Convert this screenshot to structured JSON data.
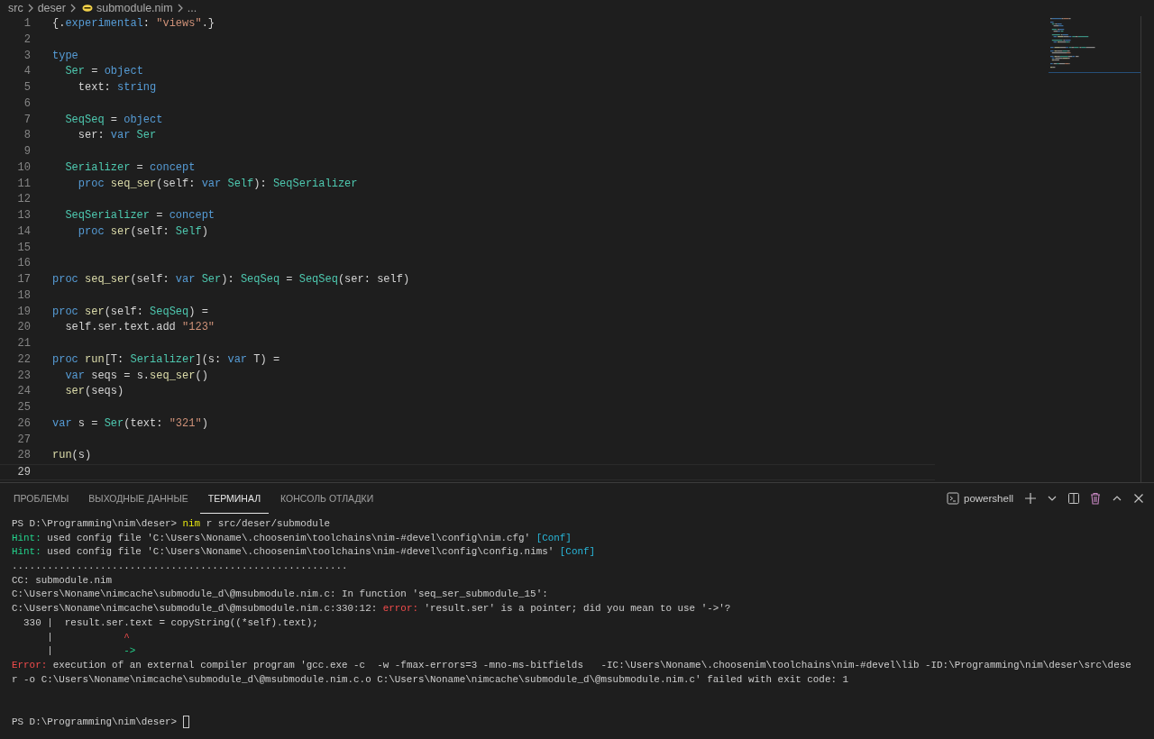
{
  "breadcrumb": [
    {
      "label": "src",
      "kind": "folder"
    },
    {
      "label": "deser",
      "kind": "folder"
    },
    {
      "label": "submodule.nim",
      "kind": "file"
    },
    {
      "label": "...",
      "kind": "more"
    }
  ],
  "editor": {
    "lines": [
      {
        "number": "1",
        "current": false,
        "segments": [
          {
            "kind": "plain",
            "text": "{."
          },
          {
            "kind": "keyword",
            "text": "experimental"
          },
          {
            "kind": "plain",
            "text": ": "
          },
          {
            "kind": "string",
            "text": "\"views\""
          },
          {
            "kind": "plain",
            "text": ".}"
          }
        ]
      },
      {
        "number": "2",
        "current": false
      },
      {
        "number": "3",
        "current": false,
        "segments": [
          {
            "kind": "keyword",
            "text": "type"
          }
        ]
      },
      {
        "number": "4",
        "current": false,
        "segments": [
          {
            "kind": "type",
            "text": "  Ser"
          },
          {
            "kind": "plain",
            "text": " = "
          },
          {
            "kind": "keyword",
            "text": "object"
          }
        ]
      },
      {
        "number": "5",
        "current": false,
        "segments": [
          {
            "kind": "plain",
            "text": "    text: "
          },
          {
            "kind": "keyword",
            "text": "string"
          }
        ]
      },
      {
        "number": "6",
        "current": false
      },
      {
        "number": "7",
        "current": false,
        "segments": [
          {
            "kind": "type",
            "text": "  SeqSeq"
          },
          {
            "kind": "plain",
            "text": " = "
          },
          {
            "kind": "keyword",
            "text": "object"
          }
        ]
      },
      {
        "number": "8",
        "current": false,
        "segments": [
          {
            "kind": "plain",
            "text": "    ser: "
          },
          {
            "kind": "keyword",
            "text": "var"
          },
          {
            "kind": "type",
            "text": " Ser"
          }
        ]
      },
      {
        "number": "9",
        "current": false
      },
      {
        "number": "10",
        "current": false,
        "segments": [
          {
            "kind": "type",
            "text": "  Serializer"
          },
          {
            "kind": "plain",
            "text": " = "
          },
          {
            "kind": "keyword",
            "text": "concept"
          }
        ]
      },
      {
        "number": "11",
        "current": false,
        "segments": [
          {
            "kind": "keyword",
            "text": "    proc"
          },
          {
            "kind": "function",
            "text": " seq_ser"
          },
          {
            "kind": "plain",
            "text": "(self: "
          },
          {
            "kind": "keyword",
            "text": "var"
          },
          {
            "kind": "type",
            "text": " Self"
          },
          {
            "kind": "plain",
            "text": "): "
          },
          {
            "kind": "type",
            "text": "SeqSerializer"
          }
        ]
      },
      {
        "number": "12",
        "current": false
      },
      {
        "number": "13",
        "current": false,
        "segments": [
          {
            "kind": "type",
            "text": "  SeqSerializer"
          },
          {
            "kind": "plain",
            "text": " = "
          },
          {
            "kind": "keyword",
            "text": "concept"
          }
        ]
      },
      {
        "number": "14",
        "current": false,
        "segments": [
          {
            "kind": "keyword",
            "text": "    proc"
          },
          {
            "kind": "function",
            "text": " ser"
          },
          {
            "kind": "plain",
            "text": "(self: "
          },
          {
            "kind": "type",
            "text": "Self"
          },
          {
            "kind": "plain",
            "text": ")"
          }
        ]
      },
      {
        "number": "15",
        "current": false
      },
      {
        "number": "16",
        "current": false
      },
      {
        "number": "17",
        "current": false,
        "segments": [
          {
            "kind": "keyword",
            "text": "proc"
          },
          {
            "kind": "function",
            "text": " seq_ser"
          },
          {
            "kind": "plain",
            "text": "(self: "
          },
          {
            "kind": "keyword",
            "text": "var"
          },
          {
            "kind": "type",
            "text": " Ser"
          },
          {
            "kind": "plain",
            "text": "): "
          },
          {
            "kind": "type",
            "text": "SeqSeq"
          },
          {
            "kind": "plain",
            "text": " = "
          },
          {
            "kind": "type",
            "text": "SeqSeq"
          },
          {
            "kind": "plain",
            "text": "(ser: self)"
          }
        ]
      },
      {
        "number": "18",
        "current": false
      },
      {
        "number": "19",
        "current": false,
        "segments": [
          {
            "kind": "keyword",
            "text": "proc"
          },
          {
            "kind": "function",
            "text": " ser"
          },
          {
            "kind": "plain",
            "text": "(self: "
          },
          {
            "kind": "type",
            "text": "SeqSeq"
          },
          {
            "kind": "plain",
            "text": ") ="
          }
        ]
      },
      {
        "number": "20",
        "current": false,
        "segments": [
          {
            "kind": "plain",
            "text": "  self.ser.text.add "
          },
          {
            "kind": "string",
            "text": "\"123\""
          }
        ]
      },
      {
        "number": "21",
        "current": false
      },
      {
        "number": "22",
        "current": false,
        "segments": [
          {
            "kind": "keyword",
            "text": "proc"
          },
          {
            "kind": "function",
            "text": " run"
          },
          {
            "kind": "plain",
            "text": "[T: "
          },
          {
            "kind": "type",
            "text": "Serializer"
          },
          {
            "kind": "plain",
            "text": "](s: "
          },
          {
            "kind": "keyword",
            "text": "var"
          },
          {
            "kind": "plain",
            "text": " T) ="
          }
        ]
      },
      {
        "number": "23",
        "current": false,
        "segments": [
          {
            "kind": "keyword",
            "text": "  var"
          },
          {
            "kind": "plain",
            "text": " seqs = s."
          },
          {
            "kind": "function",
            "text": "seq_ser"
          },
          {
            "kind": "plain",
            "text": "()"
          }
        ]
      },
      {
        "number": "24",
        "current": false,
        "segments": [
          {
            "kind": "function",
            "text": "  ser"
          },
          {
            "kind": "plain",
            "text": "(seqs)"
          }
        ]
      },
      {
        "number": "25",
        "current": false
      },
      {
        "number": "26",
        "current": false,
        "segments": [
          {
            "kind": "keyword",
            "text": "var"
          },
          {
            "kind": "plain",
            "text": " s = "
          },
          {
            "kind": "type",
            "text": "Ser"
          },
          {
            "kind": "plain",
            "text": "(text: "
          },
          {
            "kind": "string",
            "text": "\"321\""
          },
          {
            "kind": "plain",
            "text": ")"
          }
        ]
      },
      {
        "number": "27",
        "current": false
      },
      {
        "number": "28",
        "current": false,
        "segments": [
          {
            "kind": "function",
            "text": "run"
          },
          {
            "kind": "plain",
            "text": "(s)"
          }
        ]
      },
      {
        "number": "29",
        "current": true
      }
    ]
  },
  "panel": {
    "tabs": [
      {
        "label": "ПРОБЛЕМЫ",
        "selected": false
      },
      {
        "label": "ВЫХОДНЫЕ ДАННЫЕ",
        "selected": false
      },
      {
        "label": "ТЕРМИНАЛ",
        "selected": true
      },
      {
        "label": "КОНСОЛЬ ОТЛАДКИ",
        "selected": false
      }
    ],
    "shell": "powershell",
    "terminal": {
      "cursor": true,
      "lines": [
        {
          "kind": "text",
          "segments": [
            {
              "kind": "plain",
              "text": "PS D:\\Programming\\nim\\deser> "
            },
            {
              "kind": "command",
              "text": "nim"
            },
            {
              "kind": "plain",
              "text": " r src/deser/submodule"
            }
          ]
        },
        {
          "kind": "text",
          "segments": [
            {
              "kind": "hint",
              "text": "Hint:"
            },
            {
              "kind": "plain",
              "text": " used config file 'C:\\Users\\Noname\\.choosenim\\toolchains\\nim-#devel\\config\\nim.cfg' "
            },
            {
              "kind": "link",
              "text": "[Conf]"
            }
          ]
        },
        {
          "kind": "text",
          "segments": [
            {
              "kind": "hint",
              "text": "Hint:"
            },
            {
              "kind": "plain",
              "text": " used config file 'C:\\Users\\Noname\\.choosenim\\toolchains\\nim-#devel\\config\\config.nims' "
            },
            {
              "kind": "link",
              "text": "[Conf]"
            }
          ]
        },
        {
          "kind": "text",
          "segments": [
            {
              "kind": "plain",
              "text": "........................................................."
            }
          ]
        },
        {
          "kind": "text",
          "segments": [
            {
              "kind": "plain",
              "text": "CC: submodule.nim"
            }
          ]
        },
        {
          "kind": "text",
          "segments": [
            {
              "kind": "plain",
              "text": "C:\\Users\\Noname\\nimcache\\submodule_d\\@msubmodule.nim.c: In function 'seq_ser_submodule_15':"
            }
          ]
        },
        {
          "kind": "text",
          "segments": [
            {
              "kind": "plain",
              "text": "C:\\Users\\Noname\\nimcache\\submodule_d\\@msubmodule.nim.c:330:12: "
            },
            {
              "kind": "error",
              "text": "error:"
            },
            {
              "kind": "plain",
              "text": " 'result.ser' is a pointer; did you mean to use '->'?"
            }
          ]
        },
        {
          "kind": "text",
          "segments": [
            {
              "kind": "plain",
              "text": "  330 |  result.ser.text = copyString((*self).text);"
            }
          ]
        },
        {
          "kind": "text",
          "segments": [
            {
              "kind": "plain",
              "text": "      |"
            },
            {
              "kind": "error",
              "text": "            ^"
            }
          ]
        },
        {
          "kind": "text",
          "segments": [
            {
              "kind": "plain",
              "text": "      |"
            },
            {
              "kind": "success",
              "text": "            ->"
            }
          ]
        },
        {
          "kind": "text",
          "segments": [
            {
              "kind": "error",
              "text": "Error:"
            },
            {
              "kind": "plain",
              "text": " execution of an external compiler program 'gcc.exe -c  -w -fmax-errors=3 -mno-ms-bitfields   -IC:\\Users\\Noname\\.choosenim\\toolchains\\nim-#devel\\lib -ID:\\Programming\\nim\\deser\\src\\dese"
            }
          ]
        },
        {
          "kind": "text",
          "segments": [
            {
              "kind": "plain",
              "text": "r -o C:\\Users\\Noname\\nimcache\\submodule_d\\@msubmodule.nim.c.o C:\\Users\\Noname\\nimcache\\submodule_d\\@msubmodule.nim.c' failed with exit code: 1"
            }
          ]
        },
        {
          "kind": "blank"
        },
        {
          "kind": "blank"
        },
        {
          "kind": "text",
          "segments": [
            {
              "kind": "plain",
              "text": "PS D:\\Programming\\nim\\deser>"
            }
          ]
        }
      ]
    }
  }
}
